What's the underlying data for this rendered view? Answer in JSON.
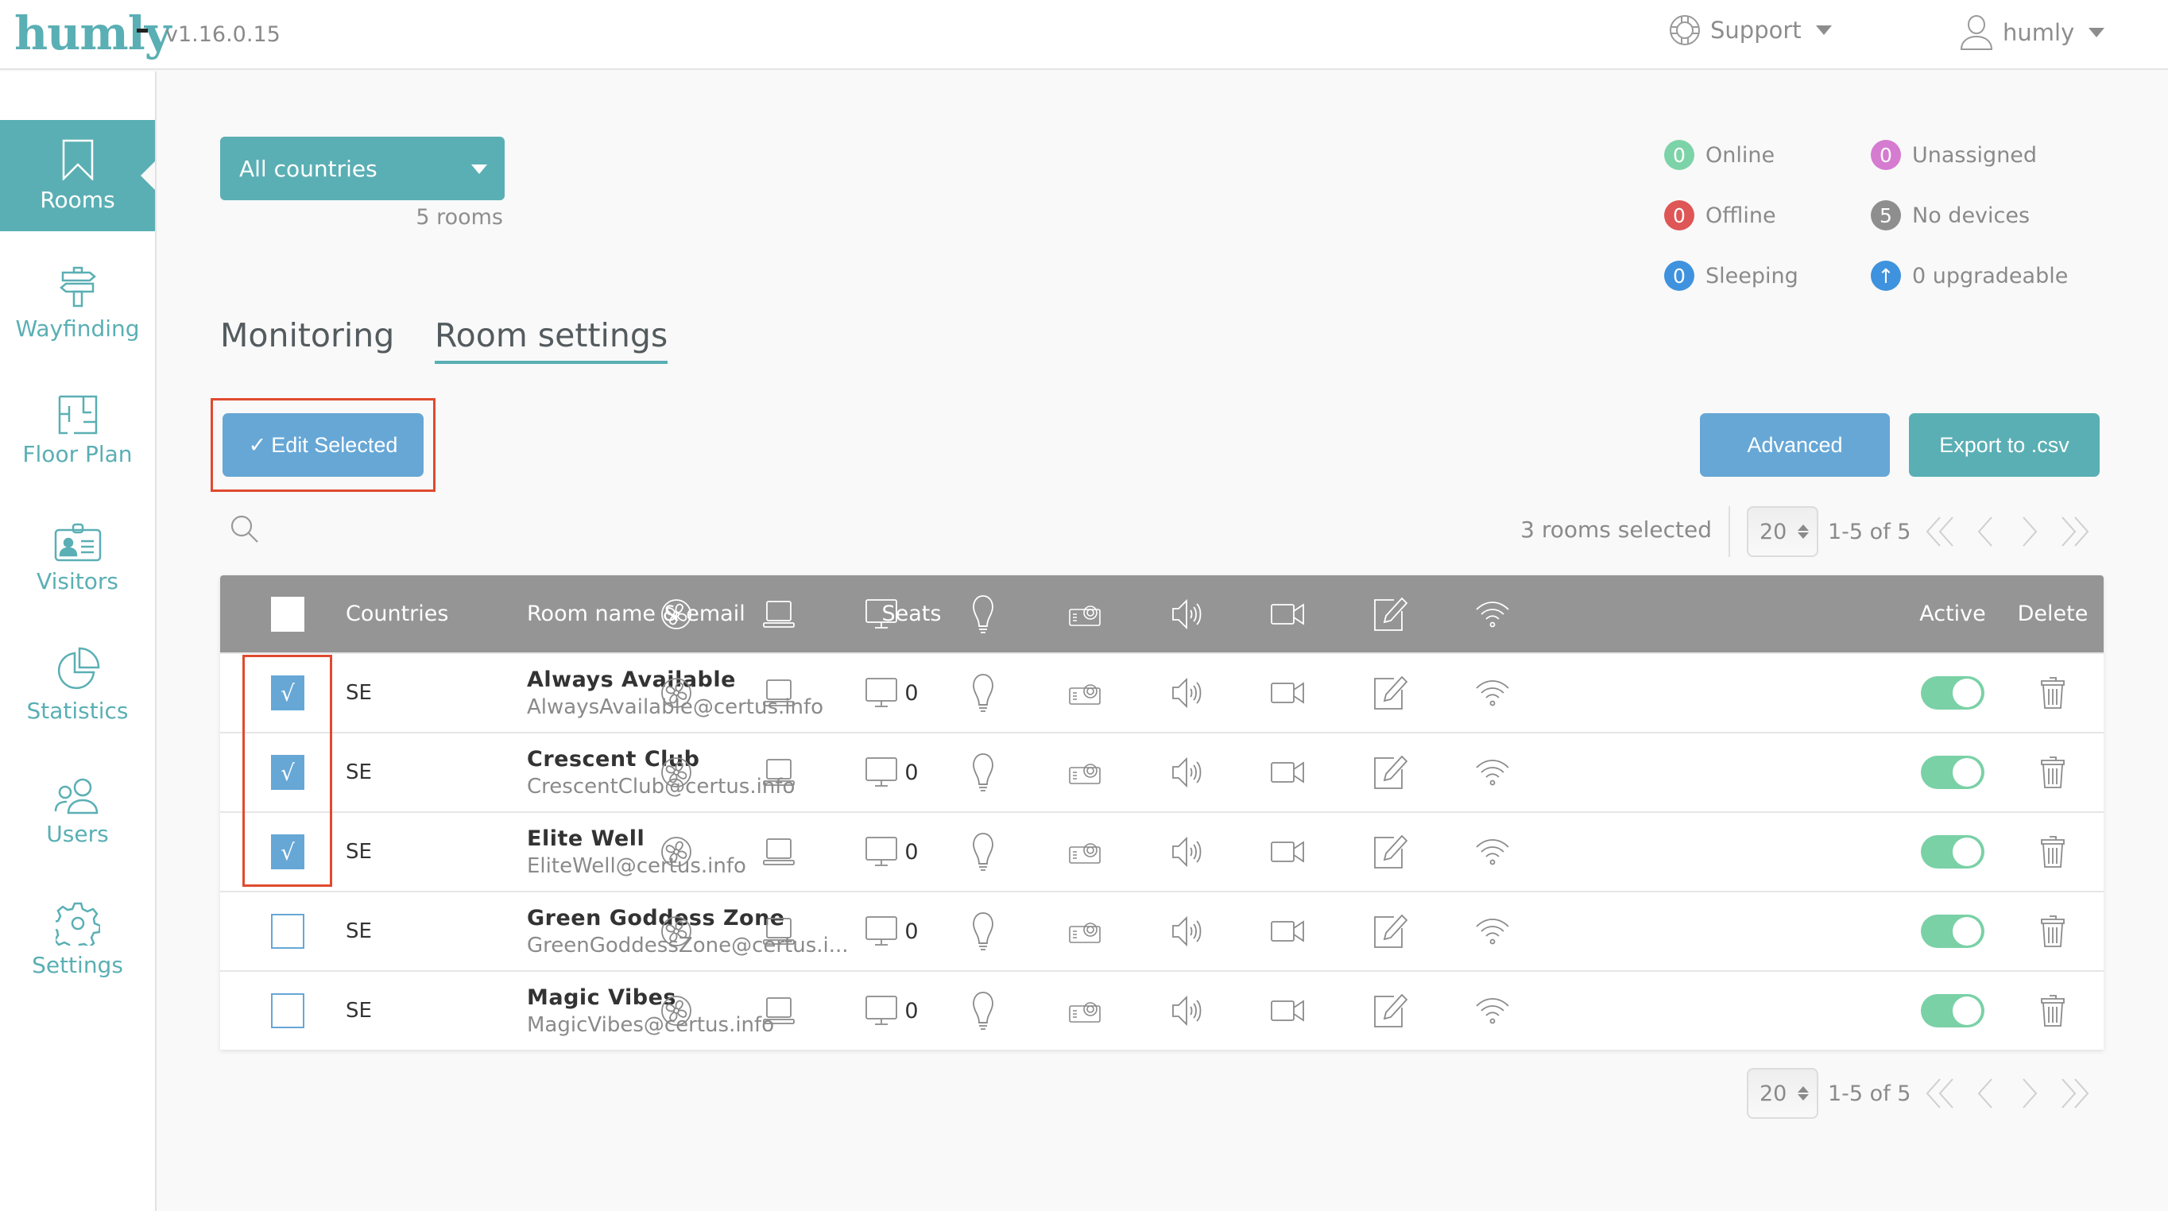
{
  "app": {
    "logo": "humly",
    "version": "v1.16.0.15"
  },
  "header": {
    "support_label": "Support",
    "user_label": "humly"
  },
  "sidebar": {
    "items": [
      {
        "label": "Rooms",
        "icon": "bookmark-icon",
        "active": true
      },
      {
        "label": "Wayfinding",
        "icon": "signpost-icon",
        "active": false
      },
      {
        "label": "Floor Plan",
        "icon": "floor-plan-icon",
        "active": false
      },
      {
        "label": "Visitors",
        "icon": "id-badge-icon",
        "active": false
      },
      {
        "label": "Statistics",
        "icon": "pie-chart-icon",
        "active": false
      },
      {
        "label": "Users",
        "icon": "users-icon",
        "active": false
      },
      {
        "label": "Settings",
        "icon": "gear-icon",
        "active": false
      }
    ]
  },
  "filter": {
    "country_selected": "All countries",
    "rooms_count": "5 rooms"
  },
  "status_legend": [
    {
      "count": "0",
      "label": "Online",
      "color": "#7dd3a8"
    },
    {
      "count": "0",
      "label": "Offline",
      "color": "#de5656"
    },
    {
      "count": "0",
      "label": "Sleeping",
      "color": "#3f92dd"
    },
    {
      "count": "0",
      "label": "Unassigned",
      "color": "#d57bd0"
    },
    {
      "count": "5",
      "label": "No devices",
      "color": "#8e8e8e"
    },
    {
      "count": "↑",
      "label": "0 upgradeable",
      "color": "#3f92dd"
    }
  ],
  "tabs": [
    {
      "label": "Monitoring",
      "active": false
    },
    {
      "label": "Room settings",
      "active": true
    }
  ],
  "actions": {
    "edit_selected": "Edit Selected",
    "advanced": "Advanced",
    "export": "Export to .csv"
  },
  "toolbar": {
    "selected_count": "3 rooms selected",
    "per_page": "20",
    "range": "1-5 of 5"
  },
  "table": {
    "columns": {
      "countries": "Countries",
      "room": "Room name & email",
      "seats": "Seats",
      "active": "Active",
      "delete": "Delete"
    },
    "equipment_icons": [
      "fan-icon",
      "laptop-icon",
      "monitor-icon",
      "lightbulb-icon",
      "projector-icon",
      "speaker-icon",
      "video-camera-icon",
      "whiteboard-icon",
      "wifi-icon"
    ],
    "rows": [
      {
        "checked": true,
        "country": "SE",
        "name": "Always Available",
        "email": "AlwaysAvailable@certus.info",
        "seats": "0",
        "active": true
      },
      {
        "checked": true,
        "country": "SE",
        "name": "Crescent Club",
        "email": "CrescentClub@certus.info",
        "seats": "0",
        "active": true
      },
      {
        "checked": true,
        "country": "SE",
        "name": "Elite Well",
        "email": "EliteWell@certus.info",
        "seats": "0",
        "active": true
      },
      {
        "checked": false,
        "country": "SE",
        "name": "Green Goddess Zone",
        "email": "GreenGoddessZone@certus.i...",
        "seats": "0",
        "active": true
      },
      {
        "checked": false,
        "country": "SE",
        "name": "Magic Vibes",
        "email": "MagicVibes@certus.info",
        "seats": "0",
        "active": true
      }
    ]
  },
  "footer_pager": {
    "per_page": "20",
    "range": "1-5 of 5"
  },
  "check_mark": "✓",
  "row_check_mark": "√"
}
